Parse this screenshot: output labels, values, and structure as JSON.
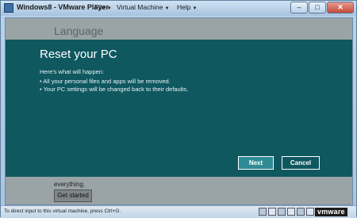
{
  "window": {
    "title": "Windows8 - VMware Player",
    "menus": [
      "File",
      "Virtual Machine",
      "Help"
    ],
    "buttons": {
      "minimize": "–",
      "maximize": "□",
      "close": "✕"
    }
  },
  "background_screen": {
    "heading": "Language",
    "text": "everything.",
    "button": "Get started"
  },
  "dialog": {
    "title": "Reset your PC",
    "intro": "Here's what will happen:",
    "items": [
      "All your personal files and apps will be removed.",
      "Your PC settings will be changed back to their defaults."
    ],
    "next_label": "Next",
    "cancel_label": "Cancel"
  },
  "statusbar": {
    "text": "To direct input to this virtual machine, press Ctrl+G.",
    "device_icons": [
      "hdd-icon",
      "cd-icon",
      "floppy-icon",
      "network-icon",
      "usb-icon",
      "sound-icon",
      "printer-icon",
      "display-icon"
    ],
    "brand": "vmware"
  },
  "colors": {
    "dialog_bg": "#0f5860",
    "next_button": "#2f8a93",
    "guest_bg": "#9aa3a5"
  }
}
